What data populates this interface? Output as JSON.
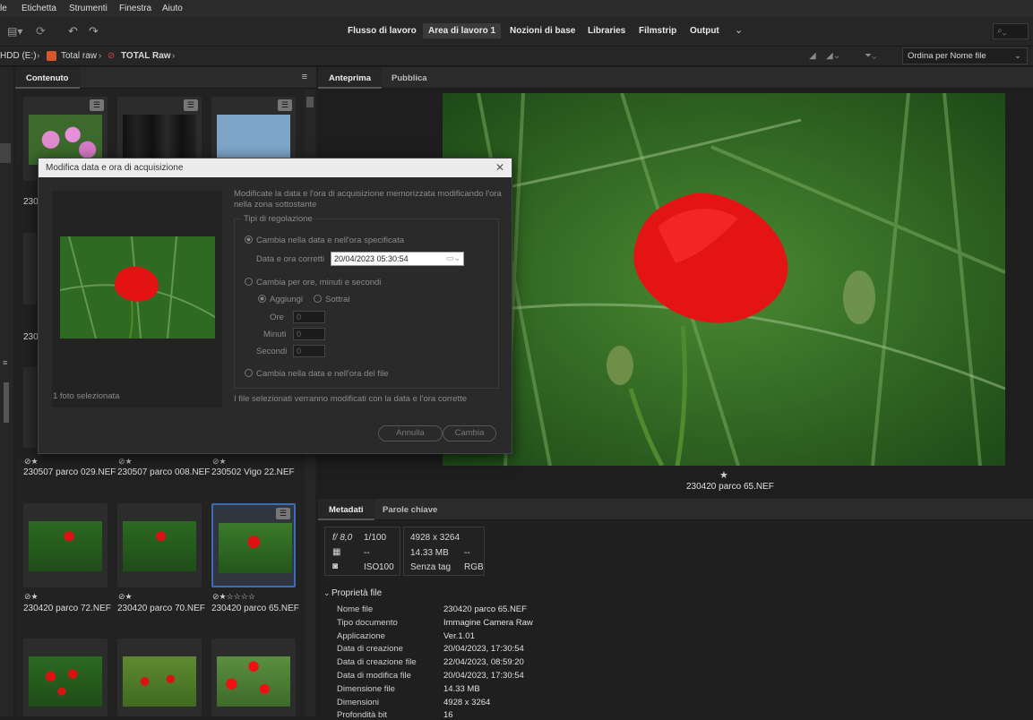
{
  "menu": [
    "le",
    "Etichetta",
    "Strumenti",
    "Finestra",
    "Aiuto"
  ],
  "workspaces": [
    "Flusso di lavoro",
    "Area di lavoro 1",
    "Nozioni di base",
    "Libraries",
    "Filmstrip",
    "Output"
  ],
  "path": {
    "drive": "HDD (E:)",
    "folder1": "Total raw",
    "folder2": "TOTAL Raw"
  },
  "sort_label": "Ordina per Nome file",
  "content_tab": "Contenuto",
  "preview_tabs": [
    "Anteprima",
    "Pubblica"
  ],
  "thumbs": {
    "row3": [
      {
        "name": "230507 parco 029.NEF",
        "rating": "⊘★"
      },
      {
        "name": "230507 parco 008.NEF",
        "rating": "⊘★"
      },
      {
        "name": "230502 Vigo 22.NEF",
        "rating": "⊘★"
      }
    ],
    "row4": [
      {
        "name": "230420 parco 72.NEF",
        "rating": "⊘★"
      },
      {
        "name": "230420 parco 70.NEF",
        "rating": "⊘★"
      },
      {
        "name": "230420 parco 65.NEF",
        "rating": "⊘★☆☆☆☆"
      }
    ],
    "partial1": "230",
    "partial2": "230"
  },
  "preview": {
    "rating": "★",
    "filename": "230420 parco 65.NEF"
  },
  "meta_tabs": [
    "Metadati",
    "Parole chiave"
  ],
  "meta_summary": {
    "aperture": "f/ 8,0",
    "shutter": "1/100",
    "dims": "4928 x 3264",
    "dash1": "--",
    "size": "14.33 MB",
    "dash2": "--",
    "iso_label": "ISO",
    "iso": "100",
    "tag": "Senza tag",
    "color": "RGB"
  },
  "section_title": "Proprietà file",
  "meta_rows": [
    {
      "k": "Nome file",
      "v": "230420 parco 65.NEF"
    },
    {
      "k": "Tipo documento",
      "v": "Immagine Camera Raw"
    },
    {
      "k": "Applicazione",
      "v": "Ver.1.01"
    },
    {
      "k": "Data di creazione",
      "v": "20/04/2023, 17:30:54"
    },
    {
      "k": "Data di creazione file",
      "v": "22/04/2023, 08:59:20"
    },
    {
      "k": "Data di modifica file",
      "v": "20/04/2023, 17:30:54"
    },
    {
      "k": "Dimensione file",
      "v": "14.33 MB"
    },
    {
      "k": "Dimensioni",
      "v": "4928 x 3264"
    },
    {
      "k": "Profondità bit",
      "v": "16"
    }
  ],
  "dialog": {
    "title": "Modifica data e ora di acquisizione",
    "desc": "Modificate la data e l'ora di acquisizione memorizzata modificando l'ora nella zona sottostante",
    "group": "Tipi di regolazione",
    "opt1": "Cambia nella data e nell'ora specificata",
    "date_label": "Data e ora corretti",
    "date_value": "20/04/2023  05:30:54",
    "opt2": "Cambia per ore, minuti e secondi",
    "add": "Aggiungi",
    "sub": "Sottrai",
    "hours": "Ore",
    "minutes": "Minuti",
    "seconds": "Secondi",
    "zero": "0",
    "opt3": "Cambia nella data e nell'ora del file",
    "note": "I file selezionati verranno modificati con la data e l'ora corrette",
    "selected": "1 foto selezionata",
    "cancel": "Annulla",
    "ok": "Cambia"
  }
}
